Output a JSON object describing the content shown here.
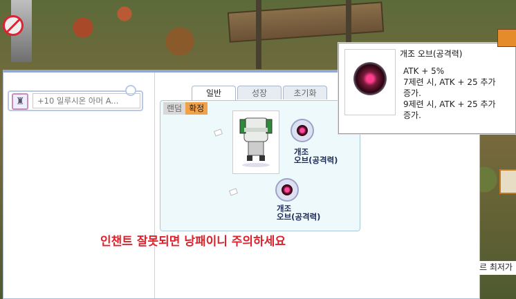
{
  "colors": {
    "warning": "#e0202a",
    "active_mode": "#f0a24a",
    "frame": "#8fa9d4"
  },
  "no_entry_icon": "no-entry-icon",
  "equip_slot": {
    "item_name": "+10 일루시온 아머 A..."
  },
  "tabs": [
    {
      "label": "일반"
    },
    {
      "label": "성장"
    },
    {
      "label": "초기화"
    }
  ],
  "mode_buttons": {
    "random": "랜덤",
    "fixed": "확정"
  },
  "orbs": [
    {
      "line1": "개조",
      "line2": "오브(공격력)",
      "icon": "orb-icon"
    },
    {
      "line1": "개조",
      "line2": "오브(공격력)",
      "icon": "orb-icon"
    }
  ],
  "warning": "인챈트 잘못되면 낭패이니 주의하세요",
  "tooltip": {
    "title": "개조 오브(공격력)",
    "lines": [
      "ATK + 5%",
      "7제련 시, ATK + 25 추가",
      "증가.",
      "9제련 시, ATK + 25 추가",
      "증가."
    ]
  },
  "right_edge_text": "르 최저가"
}
